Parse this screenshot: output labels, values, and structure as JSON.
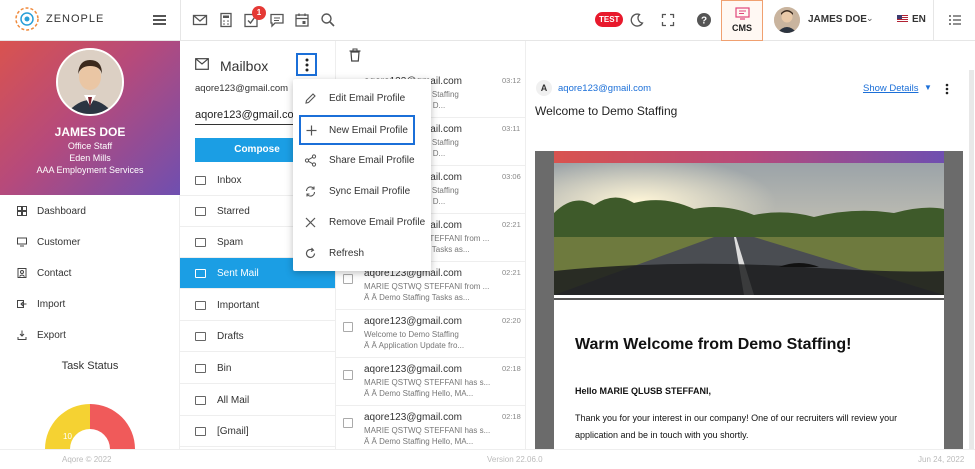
{
  "app": {
    "brand": "ZENOPLE",
    "test_badge": "TEST",
    "cms_label": "CMS",
    "notification_count": "1",
    "accent": "#1b9ee4"
  },
  "user": {
    "name": "JAMES DOE",
    "language": "EN"
  },
  "profile": {
    "name": "JAMES DOE",
    "role": "Office Staff",
    "location": "Eden Mills",
    "company": "AAA Employment Services"
  },
  "sidebar": {
    "items": [
      {
        "label": "Dashboard",
        "icon": "dashboard-icon"
      },
      {
        "label": "Customer",
        "icon": "customer-icon"
      },
      {
        "label": "Contact",
        "icon": "contact-icon"
      },
      {
        "label": "Import",
        "icon": "import-icon"
      },
      {
        "label": "Export",
        "icon": "export-icon"
      }
    ],
    "task_status_title": "Task Status",
    "task_gauge_value": "10"
  },
  "mailbox": {
    "title": "Mailbox",
    "account_email": "aqore123@gmail.com",
    "selected_profile": "aqore123@gmail.com",
    "compose_label": "Compose",
    "folders": [
      {
        "label": "Inbox",
        "active": false
      },
      {
        "label": "Starred",
        "active": false
      },
      {
        "label": "Spam",
        "active": false
      },
      {
        "label": "Sent Mail",
        "active": true
      },
      {
        "label": "Important",
        "active": false
      },
      {
        "label": "Drafts",
        "active": false
      },
      {
        "label": "Bin",
        "active": false
      },
      {
        "label": "All Mail",
        "active": false
      },
      {
        "label": "[Gmail]",
        "active": false
      }
    ]
  },
  "profile_menu": {
    "items": [
      {
        "label": "Edit Email Profile",
        "icon": "pencil-icon"
      },
      {
        "label": "New Email Profile",
        "icon": "plus-icon",
        "highlighted": true
      },
      {
        "label": "Share Email Profile",
        "icon": "share-icon"
      },
      {
        "label": "Sync Email Profile",
        "icon": "sync-icon"
      },
      {
        "label": "Remove Email Profile",
        "icon": "close-icon"
      },
      {
        "label": "Refresh",
        "icon": "refresh-icon"
      }
    ]
  },
  "messages": [
    {
      "from": "aqore123@gmail.com",
      "time": "03:12",
      "line2": "Welcome to Demo Staffing",
      "line3": "Â  Â  Welcome from D..."
    },
    {
      "from": "aqore123@gmail.com",
      "time": "03:11",
      "line2": "Welcome to Demo Staffing",
      "line3": "Â  Â  Welcome from D..."
    },
    {
      "from": "aqore123@gmail.com",
      "time": "03:06",
      "line2": "Welcome to Demo Staffing",
      "line3": "Â  Â  Welcome from D..."
    },
    {
      "from": "aqore123@gmail.com",
      "time": "02:21",
      "line2": "MARIE QSTWQ STEFFANI from ...",
      "line3": "Â  Â  Demo Staffing Tasks as..."
    },
    {
      "from": "aqore123@gmail.com",
      "time": "02:21",
      "line2": "MARIE QSTWQ STEFFANI from ...",
      "line3": "Â  Â  Demo Staffing Tasks as..."
    },
    {
      "from": "aqore123@gmail.com",
      "time": "02:20",
      "line2": "Welcome to Demo Staffing",
      "line3": "Â  Â  Application Update fro..."
    },
    {
      "from": "aqore123@gmail.com",
      "time": "02:18",
      "line2": "MARIE QSTWQ STEFFANI has s...",
      "line3": "Â  Â  Demo Staffing Hello, MA..."
    },
    {
      "from": "aqore123@gmail.com",
      "time": "02:18",
      "line2": "MARIE QSTWQ STEFFANI has s...",
      "line3": "Â  Â  Demo Staffing Hello, MA..."
    }
  ],
  "reader": {
    "avatar_letter": "A",
    "sender": "aqore123@gmail.com",
    "subject": "Welcome to Demo Staffing",
    "show_details": "Show Details",
    "email_title": "Warm Welcome from Demo Staffing!",
    "greeting": "Hello MARIE QLUSB STEFFANI,",
    "paragraph": "Thank you for your interest in our company! One of our recruiters will review your application and be in touch with you shortly."
  },
  "footer": {
    "copyright": "Aqore © 2022",
    "version": "Version 22.06.0",
    "date": "Jun 24, 2022"
  }
}
